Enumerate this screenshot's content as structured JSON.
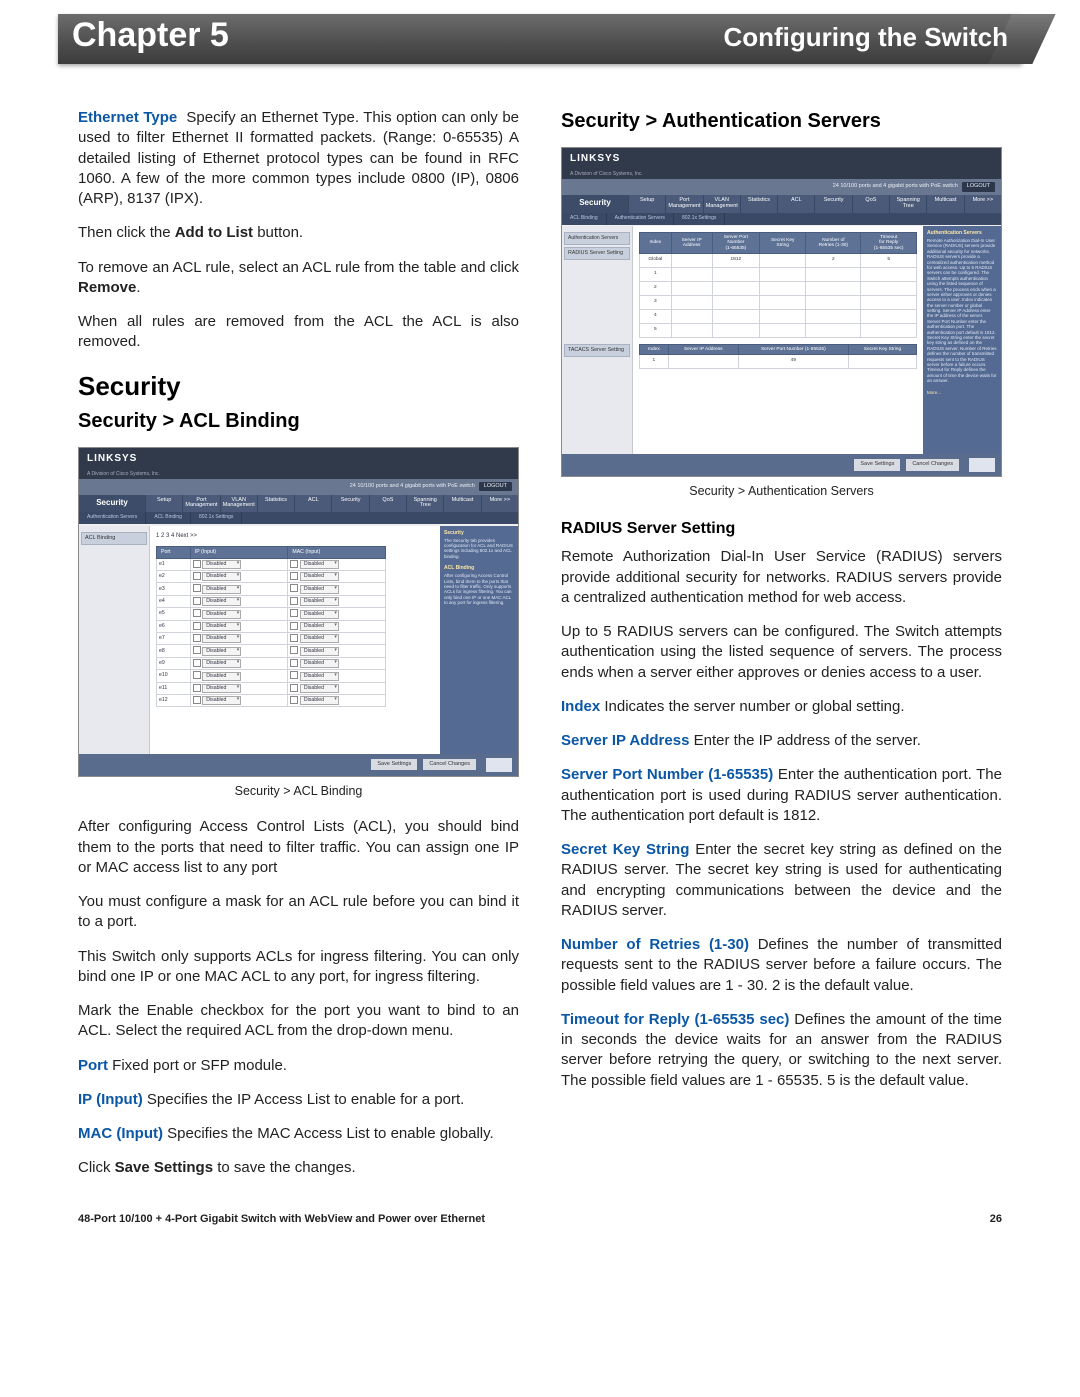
{
  "header": {
    "chapter": "Chapter 5",
    "section": "Configuring the Switch"
  },
  "left": {
    "p_ethtype_label": "Ethernet Type",
    "p_ethtype_body": "Specify an Ethernet Type. This option can only be used to filter Ethernet II formatted packets. (Range: 0-65535) A detailed listing of Ethernet protocol types can be found in RFC 1060. A few of the more common types include 0800 (IP), 0806 (ARP), 8137 (IPX).",
    "p_addtolist_pre": "Then click the ",
    "p_addtolist_bold": "Add to List",
    "p_addtolist_post": " button.",
    "p_remove_pre": "To remove an ACL rule, select an ACL rule from the table and click ",
    "p_remove_bold": "Remove",
    "p_remove_post": ".",
    "p_allremoved": "When all rules are removed from the ACL the ACL is also removed.",
    "h2_security": "Security",
    "h3_aclbinding": "Security > ACL Binding",
    "fig_caption": "Security > ACL Binding",
    "p_after1": "After configuring Access Control Lists (ACL), you should bind them to the ports that need to filter traffic. You can assign one IP or MAC access list to any port",
    "p_after2": "You must configure a mask for an ACL rule before you can bind it to a port.",
    "p_after3": "This Switch only supports ACLs for ingress filtering. You can only bind one IP or one MAC ACL to any port, for ingress filtering.",
    "p_after4": "Mark the Enable checkbox for the port you want to bind to an ACL. Select the required ACL from the drop-down menu.",
    "def_port_label": "Port",
    "def_port_body": "Fixed port or SFP module.",
    "def_ip_label": "IP (Input)",
    "def_ip_body": "Specifies the IP Access List to enable for a port.",
    "def_mac_label": "MAC (Input)",
    "def_mac_body": "Specifies the MAC Access List to enable globally.",
    "p_save_pre": "Click ",
    "p_save_bold": "Save Settings",
    "p_save_post": " to save the changes."
  },
  "right": {
    "h3_auth": "Security > Authentication Servers",
    "fig_caption": "Security > Authentication Servers",
    "h4_radius": "RADIUS Server Setting",
    "p_r1": "Remote Authorization Dial-In User Service (RADIUS) servers provide additional security for networks. RADIUS servers provide a centralized authentication method for web access.",
    "p_r2": "Up to 5 RADIUS servers can be configured. The Switch attempts authentication using the listed sequence of servers. The process ends when a server either approves or denies access to a user.",
    "def_index_label": "Index",
    "def_index_body": "Indicates the server number or global setting.",
    "def_sip_label": "Server IP Address",
    "def_sip_body": "Enter the IP address of the server.",
    "def_spn_label": "Server Port Number (1-65535)",
    "def_spn_body": "Enter the authentication port. The authentication port is used during RADIUS server authentication. The authentication port default is 1812.",
    "def_sks_label": "Secret Key String",
    "def_sks_body": "Enter the secret key string as defined on the RADIUS server. The secret key string is used for authenticating and encrypting communications between the device and the RADIUS server.",
    "def_nr_label": "Number of Retries (1-30)",
    "def_nr_body": "Defines the number of transmitted requests sent to the RADIUS server before a failure occurs. The possible field values are 1 - 30. 2 is the default value.",
    "def_to_label": "Timeout for Reply (1-65535 sec)",
    "def_to_body": "Defines the amount of the time in seconds the device waits for an answer from the RADIUS server before retrying the query, or switching to the next server. The possible field values are 1 - 65535. 5 is the default value."
  },
  "mock_common": {
    "brand": "LINKSYS",
    "subbrand": "A Division of Cisco Systems, Inc.",
    "topstrip_text": "24 10/100 ports and 4 gigabit ports with PoE switch",
    "logout": "LOGOUT",
    "nav_label": "Security",
    "tabs": [
      "Setup",
      "Port\nManagement",
      "VLAN\nManagement",
      "Statistics",
      "ACL",
      "Security",
      "QoS",
      "Spanning\nTree",
      "Multicast",
      "More >>"
    ],
    "save_btn": "Save Settings",
    "cancel_btn": "Cancel Changes"
  },
  "acl_mock": {
    "subnav": [
      "Authentication Servers",
      "ACL Binding",
      "802.1x Settings"
    ],
    "side_item": "ACL Binding",
    "pager": "1  2  3  4  Next >>",
    "headers": [
      "Port",
      "IP (Input)",
      "MAC (Input)"
    ],
    "rows": [
      {
        "port": "e1",
        "ip": "Disabled",
        "mac": "Disabled"
      },
      {
        "port": "e2",
        "ip": "Disabled",
        "mac": "Disabled"
      },
      {
        "port": "e3",
        "ip": "Disabled",
        "mac": "Disabled"
      },
      {
        "port": "e4",
        "ip": "Disabled",
        "mac": "Disabled"
      },
      {
        "port": "e5",
        "ip": "Disabled",
        "mac": "Disabled"
      },
      {
        "port": "e6",
        "ip": "Disabled",
        "mac": "Disabled"
      },
      {
        "port": "e7",
        "ip": "Disabled",
        "mac": "Disabled"
      },
      {
        "port": "e8",
        "ip": "Disabled",
        "mac": "Disabled"
      },
      {
        "port": "e9",
        "ip": "Disabled",
        "mac": "Disabled"
      },
      {
        "port": "e10",
        "ip": "Disabled",
        "mac": "Disabled"
      },
      {
        "port": "e11",
        "ip": "Disabled",
        "mac": "Disabled"
      },
      {
        "port": "e12",
        "ip": "Disabled",
        "mac": "Disabled"
      }
    ],
    "help_title": "Security",
    "help_body": "The Security tab provides configuration for ACL and RADIUS settings including 802.1x and ACL binding.",
    "help_title2": "ACL Binding",
    "help_body2": "After configuring Access Control Lists, bind them to the ports that need to filter traffic. Only supports ACLs for ingress filtering. You can only bind one IP or one MAC ACL to any port for ingress filtering."
  },
  "auth_mock": {
    "subnav": [
      "ACL Binding",
      "Authentication Servers",
      "802.1x Settings"
    ],
    "side_title": "Authentication Servers",
    "side_item1": "RADIUS Server Setting",
    "side_item2": "TACACS Server Setting",
    "rad_headers": [
      "Index",
      "Server IP\nAddress",
      "Server Port\nNumber\n(1-65535)",
      "Secret Key\nString",
      "Number of\nRetries (1-30)",
      "Timeout\nfor Reply\n(1-65535 sec)"
    ],
    "rad_rows": [
      {
        "idx": "Global",
        "ip": "",
        "port": "1812",
        "key": "",
        "retry": "2",
        "to": "5"
      },
      {
        "idx": "1",
        "ip": "",
        "port": "",
        "key": "",
        "retry": "",
        "to": ""
      },
      {
        "idx": "2",
        "ip": "",
        "port": "",
        "key": "",
        "retry": "",
        "to": ""
      },
      {
        "idx": "3",
        "ip": "",
        "port": "",
        "key": "",
        "retry": "",
        "to": ""
      },
      {
        "idx": "4",
        "ip": "",
        "port": "",
        "key": "",
        "retry": "",
        "to": ""
      },
      {
        "idx": "5",
        "ip": "",
        "port": "",
        "key": "",
        "retry": "",
        "to": ""
      }
    ],
    "tac_headers": [
      "Index",
      "Server IP Address",
      "Server Port Number (1-65535)",
      "Secret Key String"
    ],
    "tac_rows": [
      {
        "idx": "1",
        "ip": "",
        "port": "49",
        "key": ""
      }
    ],
    "help_title": "Authentication Servers",
    "help_body": "Remote Authorization Dial-In User Service (RADIUS) servers provide additional security for networks. RADIUS servers provide a centralized authentication method for web access. Up to 5 RADIUS servers can be configured. The Switch attempts authentication using the listed sequence of servers. The process ends when a server either approves or denies access to a user. Index indicates the server number or global setting. Server IP Address enter the IP address of the server. Server Port Number enter the authentication port. The authentication port default is 1812. Secret Key String enter the secret key string as defined on the RADIUS server. Number of Retries defines the number of transmitted requests sent to the RADIUS server before a failure occurs. Timeout for Reply defines the amount of time the device waits for an answer.",
    "more": "More..."
  },
  "footer": {
    "left": "48-Port 10/100 + 4-Port Gigabit Switch with WebView and Power over Ethernet",
    "right": "26"
  }
}
